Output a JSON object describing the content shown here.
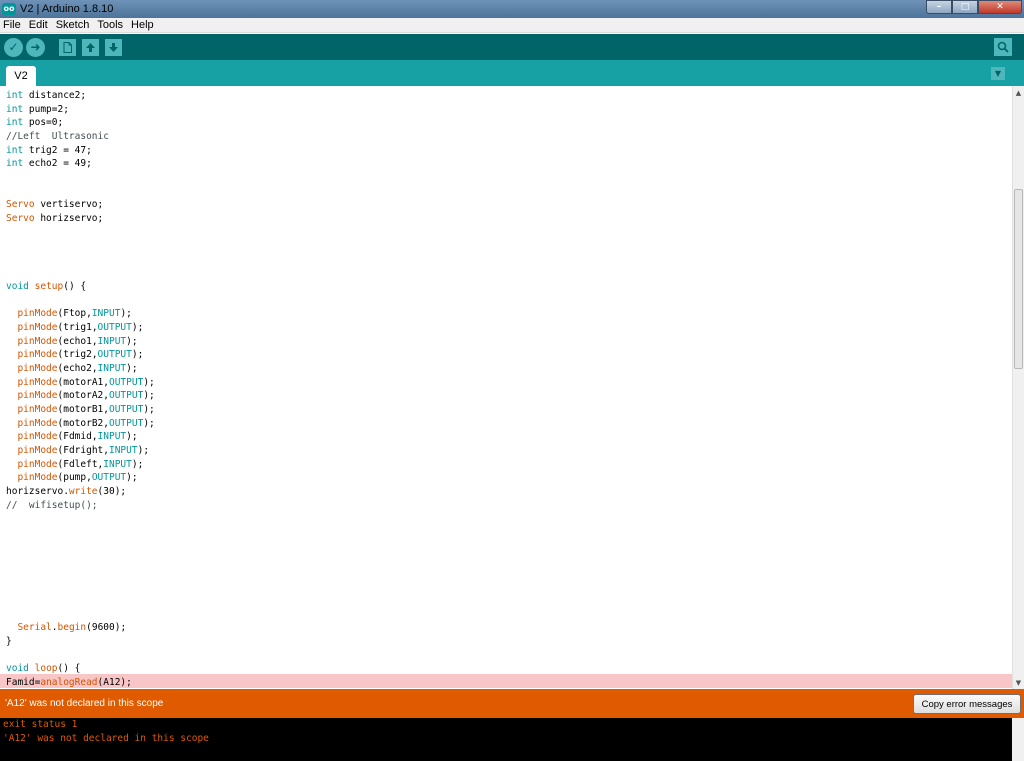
{
  "window": {
    "title": "V2 | Arduino 1.8.10",
    "logo_text": "oo",
    "minimize": "–",
    "maximize": "□",
    "close": "✕"
  },
  "menu": [
    "File",
    "Edit",
    "Sketch",
    "Tools",
    "Help"
  ],
  "toolbar": {
    "verify_icon": "check-icon",
    "upload_icon": "arrow-right-icon",
    "new_icon": "file-icon",
    "open_icon": "arrow-up-icon",
    "save_icon": "arrow-down-icon",
    "serial_icon": "magnifier-icon"
  },
  "tab": {
    "label": "V2"
  },
  "colors": {
    "keyword": "#00979c",
    "function": "#d35400",
    "toolbar": "#006468",
    "tabbar": "#17a1a5",
    "error": "#e05a00"
  },
  "code": [
    [
      [
        "kw",
        "int"
      ],
      [
        "t",
        " distance2;"
      ]
    ],
    [
      [
        "kw",
        "int"
      ],
      [
        "t",
        " pump=2;"
      ]
    ],
    [
      [
        "kw",
        "int"
      ],
      [
        "t",
        " pos=0;"
      ]
    ],
    [
      [
        "cm",
        "//Left  Ultrasonic"
      ]
    ],
    [
      [
        "kw",
        "int"
      ],
      [
        "t",
        " trig2 = 47;"
      ]
    ],
    [
      [
        "kw",
        "int"
      ],
      [
        "t",
        " echo2 = 49;"
      ]
    ],
    [],
    [],
    [
      [
        "fn",
        "Servo"
      ],
      [
        "t",
        " vertiservo;"
      ]
    ],
    [
      [
        "fn",
        "Servo"
      ],
      [
        "t",
        " horizservo;"
      ]
    ],
    [],
    [],
    [],
    [],
    [
      [
        "kw",
        "void"
      ],
      [
        "t",
        " "
      ],
      [
        "fn",
        "setup"
      ],
      [
        "t",
        "() {"
      ]
    ],
    [],
    [
      [
        "t",
        "  "
      ],
      [
        "fn",
        "pinMode"
      ],
      [
        "t",
        "(Ftop,"
      ],
      [
        "kw",
        "INPUT"
      ],
      [
        "t",
        ");"
      ]
    ],
    [
      [
        "t",
        "  "
      ],
      [
        "fn",
        "pinMode"
      ],
      [
        "t",
        "(trig1,"
      ],
      [
        "kw",
        "OUTPUT"
      ],
      [
        "t",
        ");"
      ]
    ],
    [
      [
        "t",
        "  "
      ],
      [
        "fn",
        "pinMode"
      ],
      [
        "t",
        "(echo1,"
      ],
      [
        "kw",
        "INPUT"
      ],
      [
        "t",
        ");"
      ]
    ],
    [
      [
        "t",
        "  "
      ],
      [
        "fn",
        "pinMode"
      ],
      [
        "t",
        "(trig2,"
      ],
      [
        "kw",
        "OUTPUT"
      ],
      [
        "t",
        ");"
      ]
    ],
    [
      [
        "t",
        "  "
      ],
      [
        "fn",
        "pinMode"
      ],
      [
        "t",
        "(echo2,"
      ],
      [
        "kw",
        "INPUT"
      ],
      [
        "t",
        ");"
      ]
    ],
    [
      [
        "t",
        "  "
      ],
      [
        "fn",
        "pinMode"
      ],
      [
        "t",
        "(motorA1,"
      ],
      [
        "kw",
        "OUTPUT"
      ],
      [
        "t",
        ");"
      ]
    ],
    [
      [
        "t",
        "  "
      ],
      [
        "fn",
        "pinMode"
      ],
      [
        "t",
        "(motorA2,"
      ],
      [
        "kw",
        "OUTPUT"
      ],
      [
        "t",
        ");"
      ]
    ],
    [
      [
        "t",
        "  "
      ],
      [
        "fn",
        "pinMode"
      ],
      [
        "t",
        "(motorB1,"
      ],
      [
        "kw",
        "OUTPUT"
      ],
      [
        "t",
        ");"
      ]
    ],
    [
      [
        "t",
        "  "
      ],
      [
        "fn",
        "pinMode"
      ],
      [
        "t",
        "(motorB2,"
      ],
      [
        "kw",
        "OUTPUT"
      ],
      [
        "t",
        ");"
      ]
    ],
    [
      [
        "t",
        "  "
      ],
      [
        "fn",
        "pinMode"
      ],
      [
        "t",
        "(Fdmid,"
      ],
      [
        "kw",
        "INPUT"
      ],
      [
        "t",
        ");"
      ]
    ],
    [
      [
        "t",
        "  "
      ],
      [
        "fn",
        "pinMode"
      ],
      [
        "t",
        "(Fdright,"
      ],
      [
        "kw",
        "INPUT"
      ],
      [
        "t",
        ");"
      ]
    ],
    [
      [
        "t",
        "  "
      ],
      [
        "fn",
        "pinMode"
      ],
      [
        "t",
        "(Fdleft,"
      ],
      [
        "kw",
        "INPUT"
      ],
      [
        "t",
        ");"
      ]
    ],
    [
      [
        "t",
        "  "
      ],
      [
        "fn",
        "pinMode"
      ],
      [
        "t",
        "(pump,"
      ],
      [
        "kw",
        "OUTPUT"
      ],
      [
        "t",
        ");"
      ]
    ],
    [
      [
        "t",
        "horizservo."
      ],
      [
        "fn",
        "write"
      ],
      [
        "t",
        "(30);"
      ]
    ],
    [
      [
        "cm",
        "//  wifisetup();"
      ]
    ],
    [],
    [],
    [],
    [],
    [],
    [],
    [],
    [],
    [
      [
        "t",
        "  "
      ],
      [
        "fn",
        "Serial"
      ],
      [
        "t",
        "."
      ],
      [
        "fn",
        "begin"
      ],
      [
        "t",
        "(9600);"
      ]
    ],
    [
      [
        "t",
        "}"
      ]
    ],
    [],
    [
      [
        "kw",
        "void"
      ],
      [
        "t",
        " "
      ],
      [
        "fn",
        "loop"
      ],
      [
        "t",
        "() {"
      ]
    ],
    [
      [
        "t",
        "Famid="
      ],
      [
        "fn",
        "analogRead"
      ],
      [
        "t",
        "(A12);"
      ]
    ]
  ],
  "status": {
    "error_message": "'A12' was not declared in this scope",
    "copy_button": "Copy error messages"
  },
  "console": [
    "exit status 1",
    "'A12' was not declared in this scope"
  ]
}
